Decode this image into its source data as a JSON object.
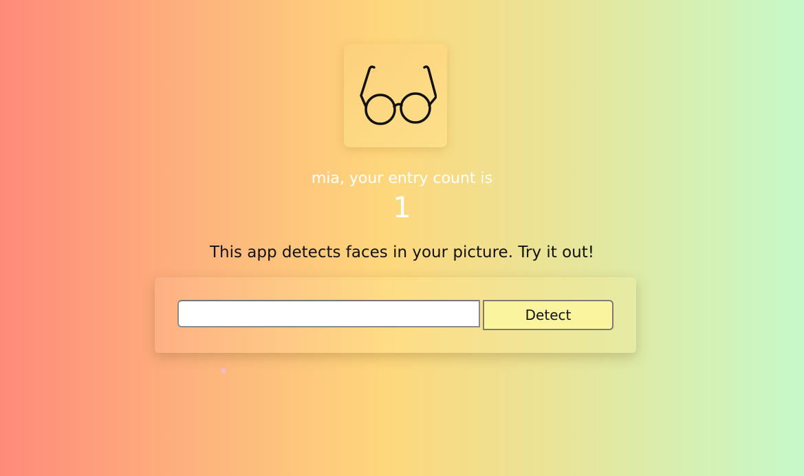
{
  "logo": {
    "icon": "glasses-icon"
  },
  "user": {
    "entry_text": "mia, your entry count is",
    "entry_count": "1"
  },
  "tagline": "This app detects faces in your picture. Try it out!",
  "form": {
    "input_value": "",
    "input_placeholder": "",
    "detect_label": "Detect"
  },
  "colors": {
    "gradient_left": "#ff8a7a",
    "gradient_mid": "#fed77c",
    "gradient_right": "#c6f9c9",
    "button_bg": "#fbf49e"
  }
}
